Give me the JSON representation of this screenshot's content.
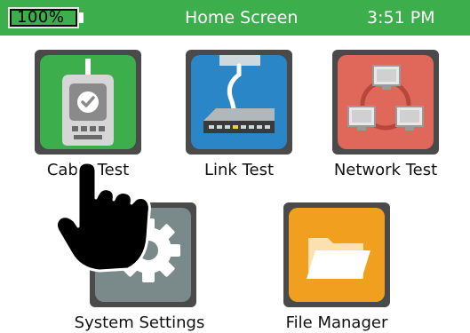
{
  "status_bar": {
    "battery_percent": "100%",
    "battery_level": 1.0,
    "title": "Home Screen",
    "time": "3:51 PM"
  },
  "apps": [
    {
      "label": "Cable Test",
      "icon": "cable-tester-icon",
      "color": "#3cae4c"
    },
    {
      "label": "Link Test",
      "icon": "network-switch-icon",
      "color": "#2b86c8"
    },
    {
      "label": "Network Test",
      "icon": "network-topology-icon",
      "color": "#e0685a"
    },
    {
      "label": "System Settings",
      "icon": "gear-icon",
      "color": "#7a8a8a"
    },
    {
      "label": "File Manager",
      "icon": "folder-icon",
      "color": "#f0a01e"
    }
  ],
  "colors": {
    "status_bar": "#3cae4c",
    "tile_border": "#4a4a4a"
  }
}
